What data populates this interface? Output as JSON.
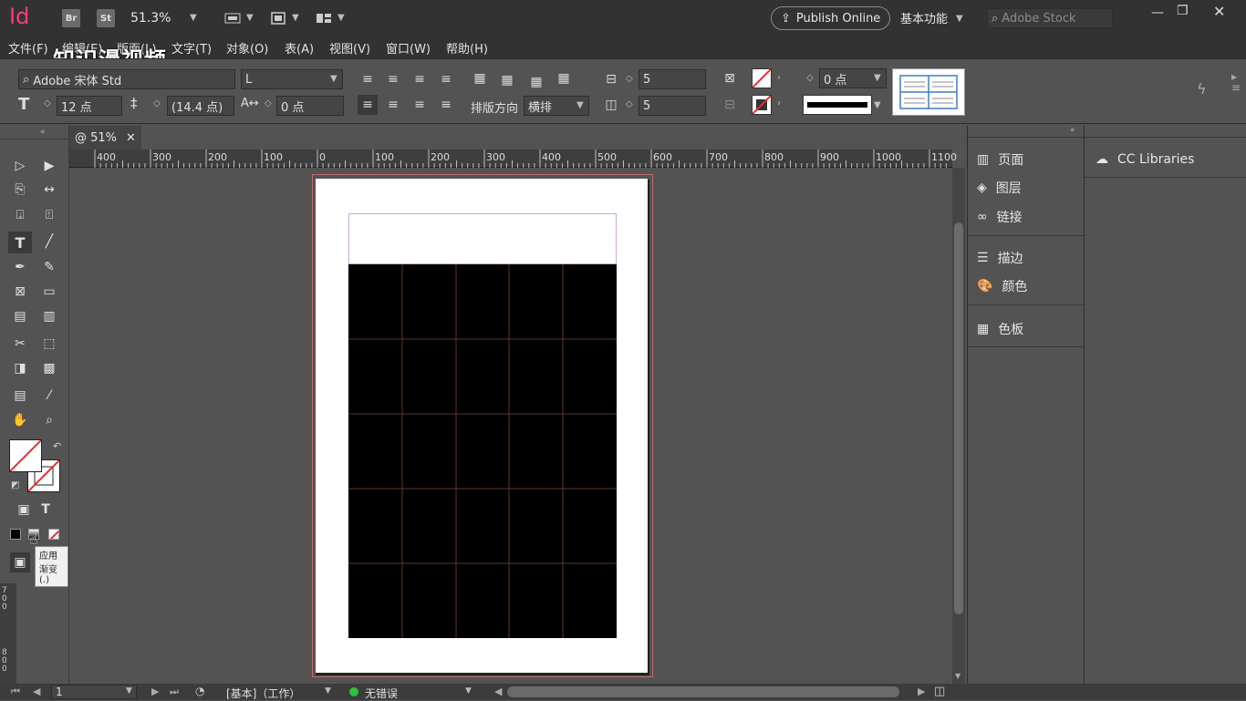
{
  "titlebar": {
    "app_logo": "Id",
    "bridge_label": "Br",
    "stock_label": "St",
    "zoom": "51.3%",
    "publish_label": "Publish Online",
    "workspace": "基本功能",
    "search_placeholder": "Adobe Stock"
  },
  "menu": [
    "文件(F)",
    "编辑(E)",
    "版面(L)",
    "文字(T)",
    "对象(O)",
    "表(A)",
    "视图(V)",
    "窗口(W)",
    "帮助(H)"
  ],
  "overlay_watermark": "知识漫视频",
  "control": {
    "font_family": "Adobe 宋体 Std",
    "font_style": "L",
    "font_size": "12 点",
    "leading": "(14.4 点)",
    "tracking": "0 点",
    "direction_label": "排版方向",
    "direction_value": "横排",
    "rows": "5",
    "cols": "5",
    "stroke_weight": "0 点"
  },
  "document": {
    "tab_label": "@ 51%",
    "ruler_labels": [
      "400",
      "300",
      "200",
      "100",
      "0",
      "100",
      "200",
      "300",
      "400",
      "500",
      "600",
      "700",
      "800",
      "900",
      "1000",
      "1100"
    ],
    "vruler_labels": [
      "700",
      "800"
    ]
  },
  "tooltip": "应用渐变 (.)",
  "panels_a": [
    "页面",
    "图层",
    "链接",
    "描边",
    "颜色",
    "色板"
  ],
  "panels_b_title": "CC Libraries",
  "status": {
    "page": "1",
    "master": "[基本]（工作）",
    "preflight": "无错误"
  },
  "colors": {
    "logo": "#ff3a7a",
    "accent_red": "#e0312b",
    "preflight_ok": "#2fbf3a"
  }
}
